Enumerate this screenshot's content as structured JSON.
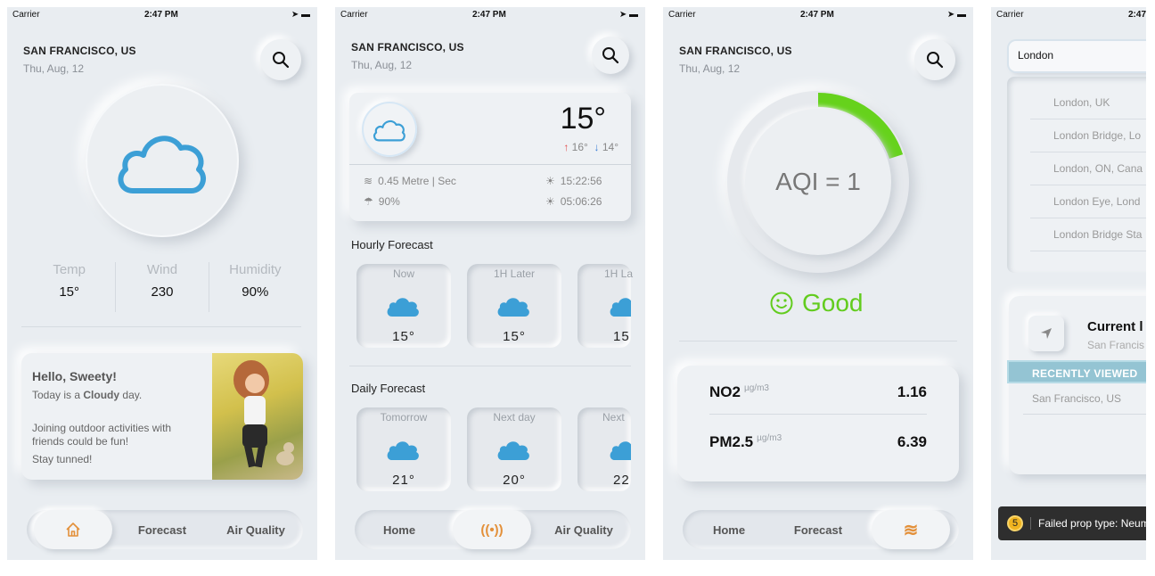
{
  "status": {
    "carrier": "Carrier",
    "time": "2:47 PM"
  },
  "location": {
    "city": "SAN FRANCISCO, US",
    "date": "Thu, Aug, 12"
  },
  "home": {
    "stats": [
      {
        "label": "Temp",
        "value": "15°"
      },
      {
        "label": "Wind",
        "value": "230"
      },
      {
        "label": "Humidity",
        "value": "90%"
      }
    ],
    "greeting": {
      "hello": "Hello, Sweety!",
      "today_prefix": "Today is a",
      "condition": "Cloudy",
      "today_suffix": "day.",
      "line1": "Joining outdoor activities with",
      "line2": "friends could be fun!",
      "line3": "Stay tunned!"
    }
  },
  "tabs": {
    "home": "Home",
    "forecast": "Forecast",
    "air_quality": "Air Quality"
  },
  "forecast": {
    "temp": "15°",
    "high": "16°",
    "low": "14°",
    "wind": "0.45 Metre | Sec",
    "humidity": "90%",
    "sunrise": "15:22:56",
    "sunset": "05:06:26",
    "hourly_title": "Hourly Forecast",
    "hourly": [
      {
        "label": "Now",
        "temp": "15°"
      },
      {
        "label": "1H Later",
        "temp": "15°"
      },
      {
        "label": "1H La",
        "temp": "15"
      }
    ],
    "daily_title": "Daily Forecast",
    "daily": [
      {
        "label": "Tomorrow",
        "temp": "21°"
      },
      {
        "label": "Next day",
        "temp": "20°"
      },
      {
        "label": "Next",
        "temp": "22"
      }
    ]
  },
  "air": {
    "aqi_text": "AQI = 1",
    "aqi_fraction": 0.2,
    "status": "Good",
    "pollutants": [
      {
        "name": "NO2",
        "unit": "µg/m3",
        "value": "1.16"
      },
      {
        "name": "PM2.5",
        "unit": "µg/m3",
        "value": "6.39"
      }
    ]
  },
  "search": {
    "query": "London",
    "suggestions": [
      "London, UK",
      "London Bridge, Lo",
      "London, ON, Cana",
      "London Eye, Lond",
      "London Bridge Sta"
    ],
    "current_title": "Current l",
    "current_sub": "San Francis",
    "recent_header": "RECENTLY VIEWED",
    "recent": [
      "San Francisco, US"
    ],
    "toast_count": "5",
    "toast_text": "Failed prop type: Neum"
  },
  "colors": {
    "accent_orange": "#e3903a",
    "good_green": "#62cc1e",
    "cloud_blue": "#3c9fd6",
    "recent_bar": "#94c4d3"
  }
}
